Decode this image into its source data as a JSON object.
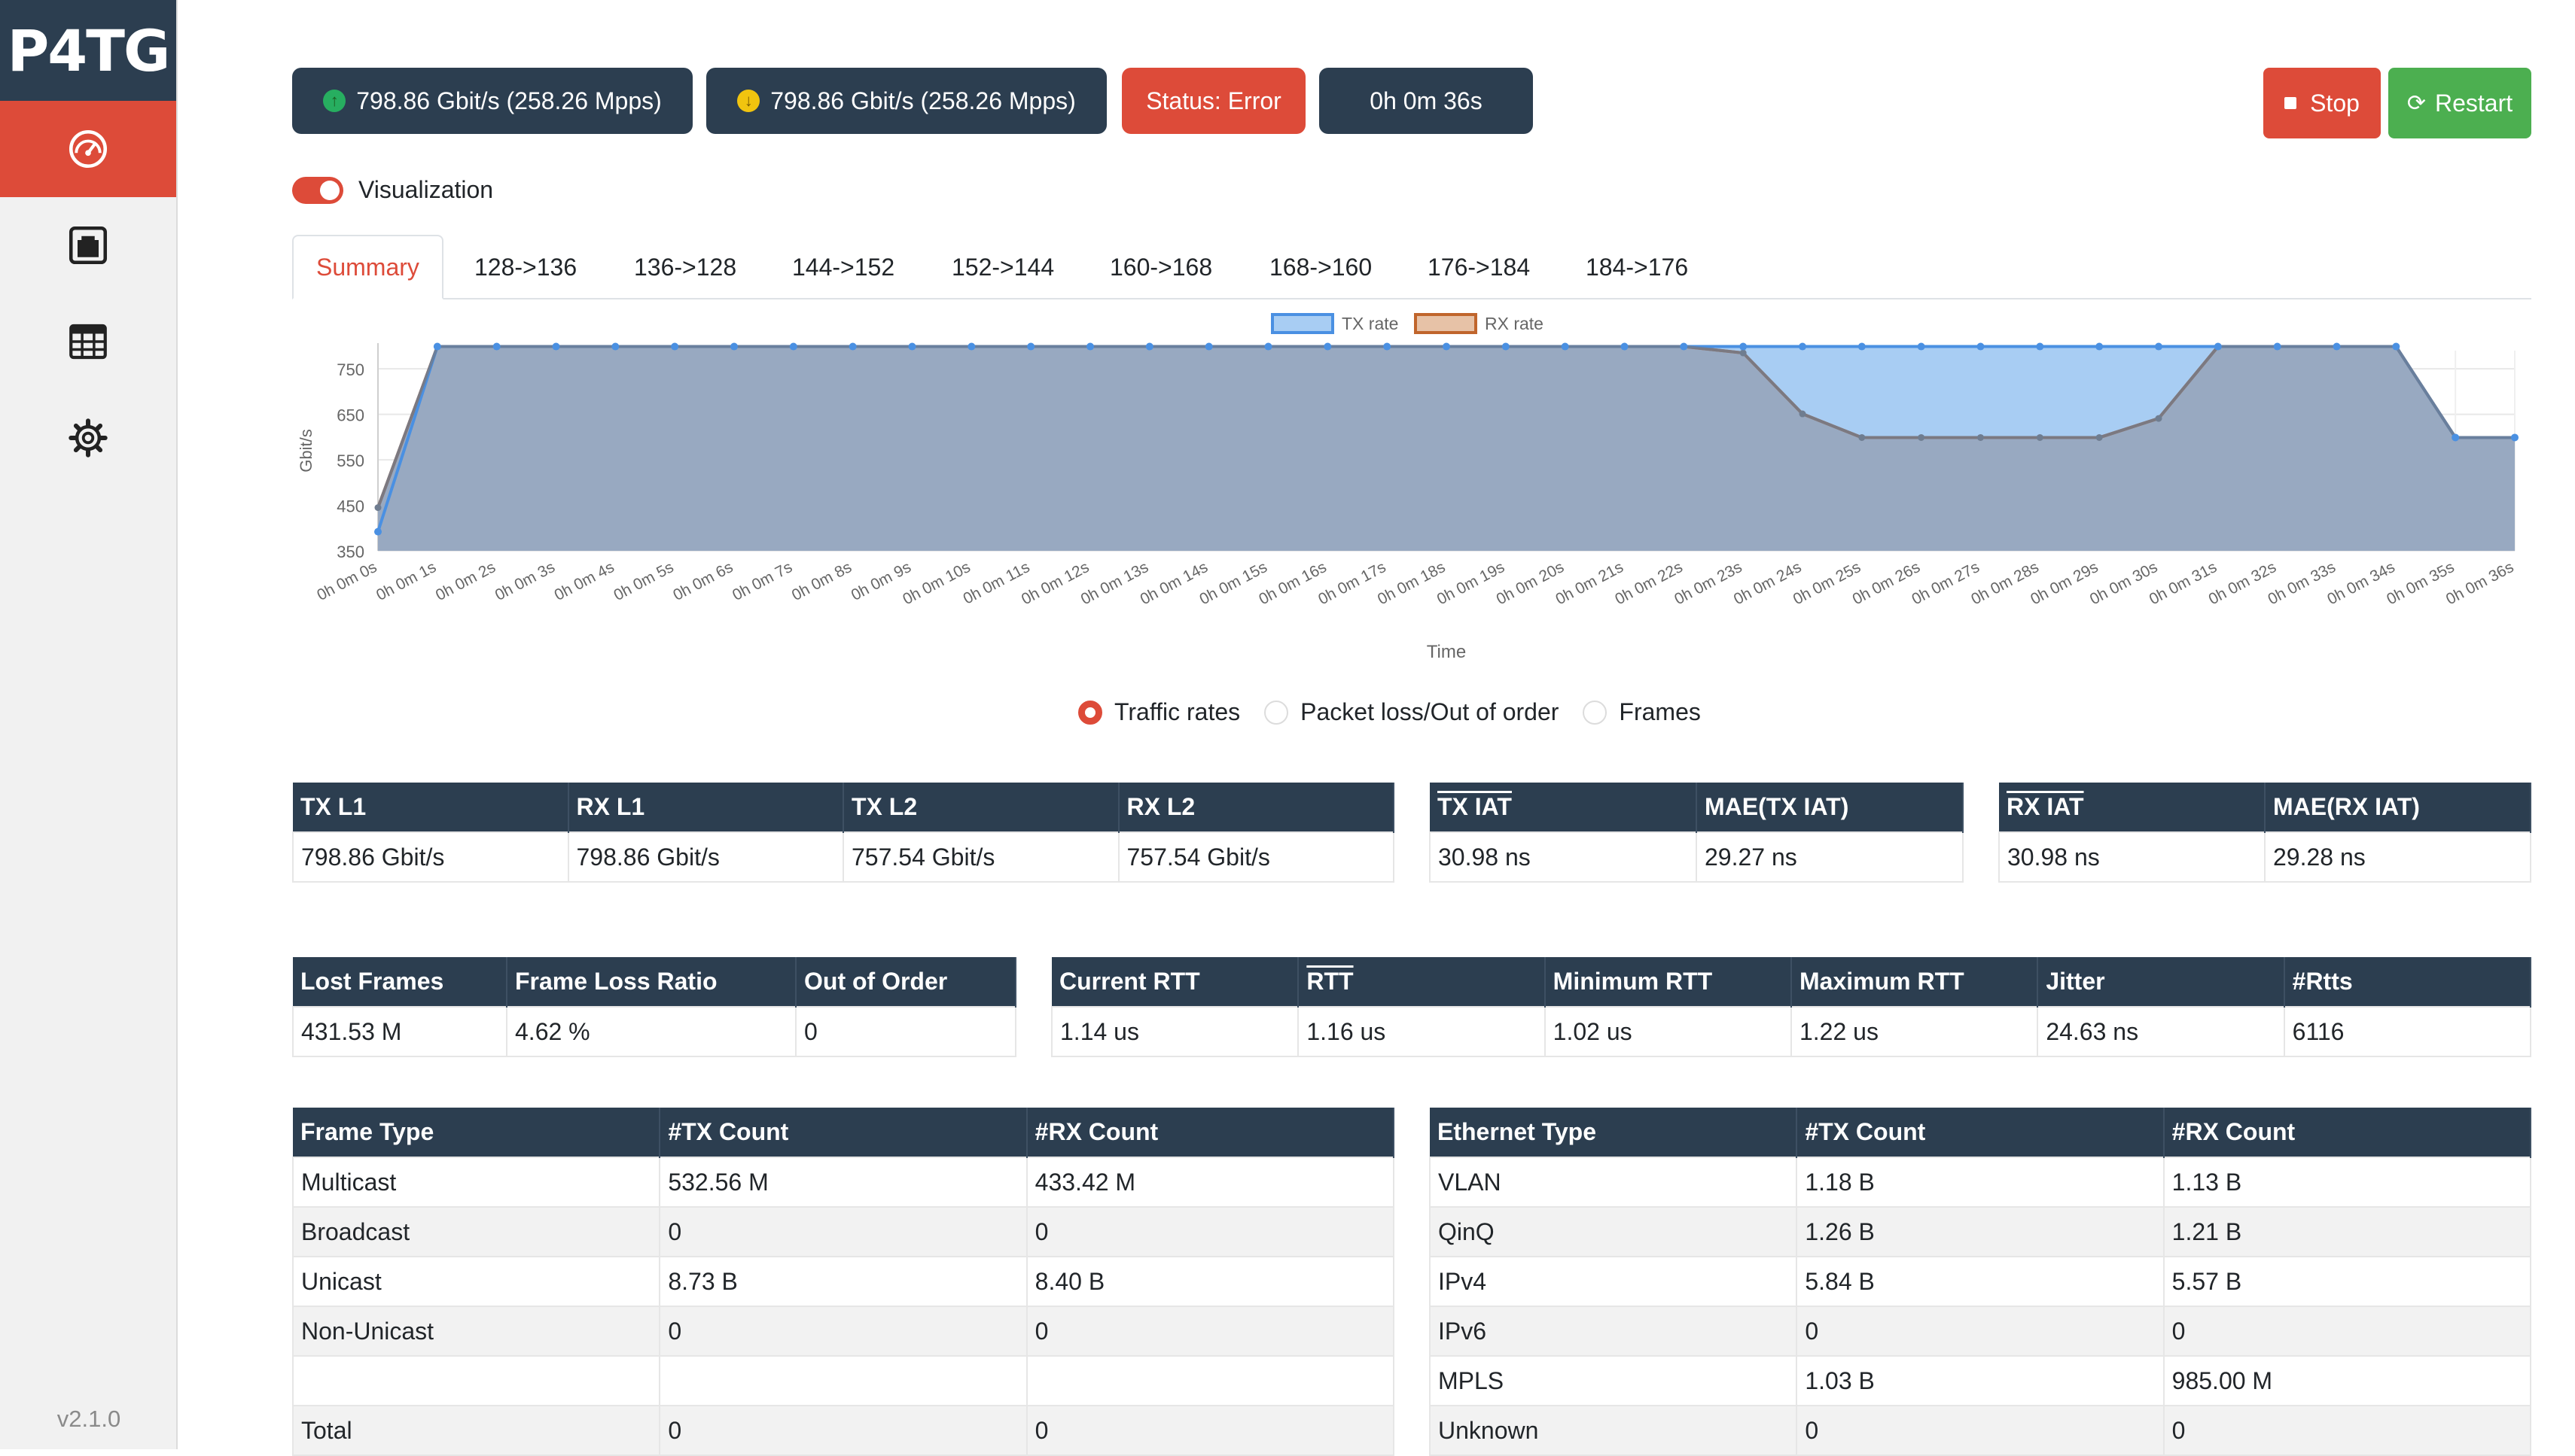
{
  "sidebar": {
    "logo": "P4TG",
    "items": [
      {
        "name": "dashboard",
        "icon": "speedometer-icon"
      },
      {
        "name": "ports",
        "icon": "ethernet-port-icon"
      },
      {
        "name": "tables",
        "icon": "table-icon"
      },
      {
        "name": "settings",
        "icon": "gear-icon"
      }
    ],
    "version": "v2.1.0"
  },
  "topbar": {
    "tx_rate": "798.86 Gbit/s (258.26 Mpps)",
    "rx_rate": "798.86 Gbit/s (258.26 Mpps)",
    "status": "Status: Error",
    "elapsed": "0h 0m 36s",
    "stop_label": "Stop",
    "restart_label": "Restart"
  },
  "visualization": {
    "label": "Visualization",
    "enabled": true
  },
  "tabs": [
    "Summary",
    "128->136",
    "136->128",
    "144->152",
    "152->144",
    "160->168",
    "168->160",
    "176->184",
    "184->176"
  ],
  "chart_data": {
    "type": "area",
    "xlabel": "Time",
    "ylabel": "Gbit/s",
    "ylim": [
      350,
      790
    ],
    "yticks": [
      "750",
      "650",
      "550",
      "450",
      "350"
    ],
    "x": [
      "0h 0m 0s",
      "0h 0m 1s",
      "0h 0m 2s",
      "0h 0m 3s",
      "0h 0m 4s",
      "0h 0m 5s",
      "0h 0m 6s",
      "0h 0m 7s",
      "0h 0m 8s",
      "0h 0m 9s",
      "0h 0m 10s",
      "0h 0m 11s",
      "0h 0m 12s",
      "0h 0m 13s",
      "0h 0m 14s",
      "0h 0m 15s",
      "0h 0m 16s",
      "0h 0m 17s",
      "0h 0m 18s",
      "0h 0m 19s",
      "0h 0m 20s",
      "0h 0m 21s",
      "0h 0m 22s",
      "0h 0m 23s",
      "0h 0m 24s",
      "0h 0m 25s",
      "0h 0m 26s",
      "0h 0m 27s",
      "0h 0m 28s",
      "0h 0m 29s",
      "0h 0m 30s",
      "0h 0m 31s",
      "0h 0m 32s",
      "0h 0m 33s",
      "0h 0m 34s",
      "0h 0m 35s",
      "0h 0m 36s"
    ],
    "legend": [
      "TX rate",
      "RX rate"
    ],
    "legend_position": "top",
    "grid": true,
    "series": [
      {
        "name": "TX rate",
        "color": "#4a90e2",
        "values": [
          392,
          799,
          799,
          799,
          799,
          799,
          799,
          799,
          799,
          799,
          799,
          799,
          799,
          799,
          799,
          799,
          799,
          799,
          799,
          799,
          799,
          799,
          799,
          799,
          799,
          799,
          799,
          799,
          799,
          799,
          799,
          799,
          799,
          799,
          799,
          599,
          599
        ]
      },
      {
        "name": "RX rate",
        "color": "#c0652c",
        "values": [
          445,
          799,
          799,
          799,
          799,
          799,
          799,
          799,
          799,
          799,
          799,
          799,
          799,
          799,
          799,
          799,
          799,
          799,
          799,
          799,
          799,
          799,
          799,
          785,
          651,
          599,
          599,
          599,
          599,
          599,
          641,
          799,
          799,
          799,
          799,
          599,
          599
        ]
      }
    ]
  },
  "view_options": {
    "items": [
      "Traffic rates",
      "Packet loss/Out of order",
      "Frames"
    ],
    "selected": "Traffic rates"
  },
  "rates_table": {
    "headers": [
      "TX L1",
      "RX L1",
      "TX L2",
      "RX L2"
    ],
    "row": [
      "798.86 Gbit/s",
      "798.86 Gbit/s",
      "757.54 Gbit/s",
      "757.54 Gbit/s"
    ]
  },
  "tx_iat_table": {
    "headers": [
      "TX IAT",
      "MAE(TX IAT)"
    ],
    "row": [
      "30.98 ns",
      "29.27 ns"
    ]
  },
  "rx_iat_table": {
    "headers": [
      "RX IAT",
      "MAE(RX IAT)"
    ],
    "row": [
      "30.98 ns",
      "29.28 ns"
    ]
  },
  "loss_table": {
    "headers": [
      "Lost Frames",
      "Frame Loss Ratio",
      "Out of Order"
    ],
    "row": [
      "431.53 M",
      "4.62 %",
      "0"
    ]
  },
  "rtt_table": {
    "headers": [
      "Current RTT",
      "RTT",
      "Minimum RTT",
      "Maximum RTT",
      "Jitter",
      "#Rtts"
    ],
    "row": [
      "1.14 us",
      "1.16 us",
      "1.02 us",
      "1.22 us",
      "24.63 ns",
      "6116"
    ]
  },
  "frame_type_table": {
    "headers": [
      "Frame Type",
      "#TX Count",
      "#RX Count"
    ],
    "rows": [
      [
        "Multicast",
        "532.56 M",
        "433.42 M"
      ],
      [
        "Broadcast",
        "0",
        "0"
      ],
      [
        "Unicast",
        "8.73 B",
        "8.40 B"
      ],
      [
        "Non-Unicast",
        "0",
        "0"
      ],
      [
        "",
        "",
        ""
      ],
      [
        "Total",
        "0",
        "0"
      ]
    ]
  },
  "ethernet_type_table": {
    "headers": [
      "Ethernet Type",
      "#TX Count",
      "#RX Count"
    ],
    "rows": [
      [
        "VLAN",
        "1.18 B",
        "1.13 B"
      ],
      [
        "QinQ",
        "1.26 B",
        "1.21 B"
      ],
      [
        "IPv4",
        "5.84 B",
        "5.57 B"
      ],
      [
        "IPv6",
        "0",
        "0"
      ],
      [
        "MPLS",
        "1.03 B",
        "985.00 M"
      ],
      [
        "Unknown",
        "0",
        "0"
      ]
    ]
  }
}
